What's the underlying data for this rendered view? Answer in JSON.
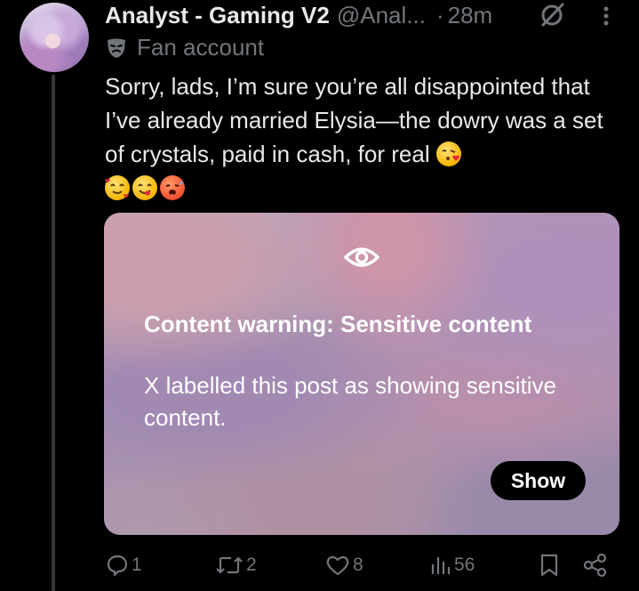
{
  "post": {
    "display_name": "Analyst - Gaming V2",
    "handle": "@Anal...",
    "dot": "·",
    "time": "28m",
    "label": "Fan account",
    "text": "Sorry, lads, I’m sure you’re all disappointed that I’ve already married Elysia—the dowry was a set of crystals, paid in cash, for real",
    "emojis": [
      "kissing-heart-emoji",
      "smiling-hearts-emoji",
      "yum-emoji",
      "hot-face-emoji"
    ]
  },
  "media": {
    "warning_title": "Content warning: Sensitive content",
    "warning_body": "X labelled this post as showing sensitive content.",
    "show_label": "Show"
  },
  "actions": {
    "replies": "1",
    "reposts": "2",
    "likes": "8",
    "views": "56"
  },
  "colors": {
    "background": "#000000",
    "text": "#e7e9ea",
    "muted": "#71767b",
    "thread_line": "#333639"
  }
}
